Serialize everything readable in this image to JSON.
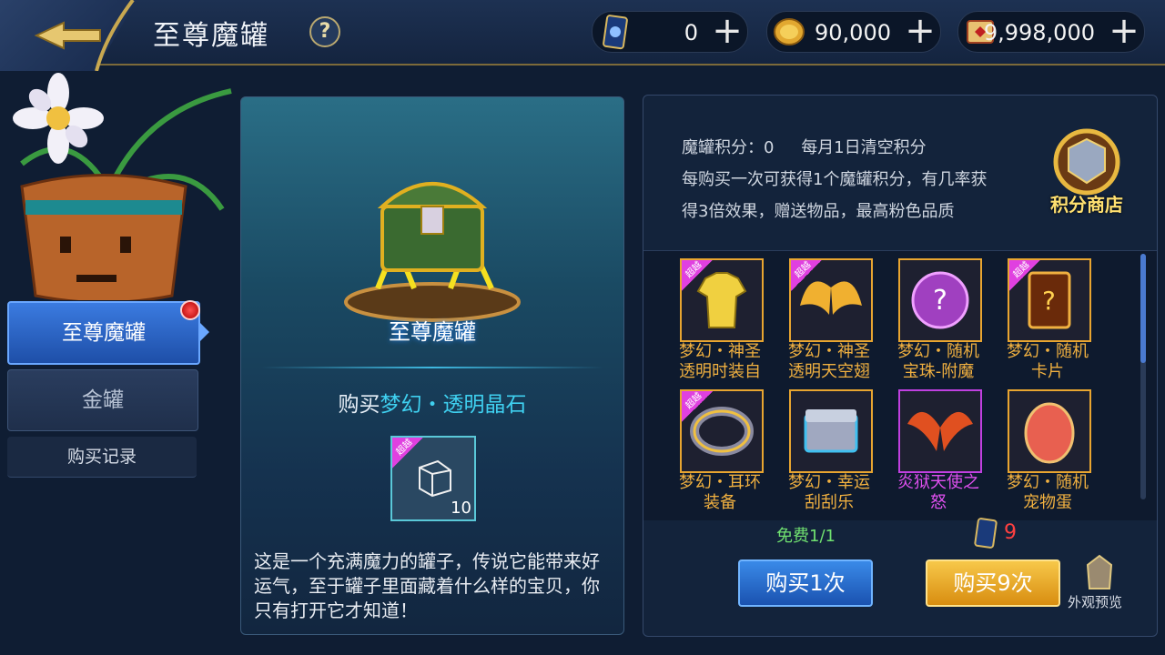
{
  "header": {
    "title": "至尊魔罐",
    "help_icon": "?",
    "currencies": [
      {
        "icon": "card-icon",
        "value": "0"
      },
      {
        "icon": "gold-coin-icon",
        "value": "90,000"
      },
      {
        "icon": "scroll-icon",
        "value": "9,998,000"
      }
    ],
    "plus": "+"
  },
  "sidebar": {
    "tabs": [
      {
        "label": "至尊魔罐",
        "active": true
      },
      {
        "label": "金罐",
        "active": false
      }
    ],
    "history_label": "购买记录"
  },
  "center": {
    "chest_name": "至尊魔罐",
    "buy_prefix": "购买",
    "buy_item": "梦幻・透明晶石",
    "reward_tag": "超越",
    "reward_qty": "10",
    "description": "这是一个充满魔力的罐子，传说它能带来好运气，至于罐子里面藏着什么样的宝贝，你只有打开它才知道！"
  },
  "right": {
    "points_line": "魔罐积分：0",
    "reset_note": "每月1日清空积分",
    "info": "每购买一次可获得1个魔罐积分，有几率获得3倍效果，赠送物品，最高粉色品质",
    "shop_label": "积分商店",
    "items": [
      {
        "line1": "梦幻・神圣",
        "line2": "透明时装自",
        "tag": "超越",
        "color": "#f0b040",
        "icon": "shirt-icon"
      },
      {
        "line1": "梦幻・神圣",
        "line2": "透明天空翅",
        "tag": "超越",
        "color": "#f0b040",
        "icon": "wings-icon"
      },
      {
        "line1": "梦幻・随机",
        "line2": "宝珠-附魔",
        "tag": "",
        "color": "#f0b040",
        "icon": "orb-icon"
      },
      {
        "line1": "梦幻・随机",
        "line2": "卡片",
        "tag": "超越",
        "color": "#f0b040",
        "icon": "card-icon"
      },
      {
        "line1": "梦幻・耳环",
        "line2": "装备",
        "tag": "超越",
        "color": "#f0b040",
        "icon": "ring-icon"
      },
      {
        "line1": "梦幻・幸运",
        "line2": "刮刮乐",
        "tag": "",
        "color": "#f0b040",
        "icon": "box-icon"
      },
      {
        "line1": "炎狱天使之",
        "line2": "怒",
        "tag": "",
        "color": "#e050f0",
        "icon": "fire-wings-icon"
      },
      {
        "line1": "梦幻・随机",
        "line2": "宠物蛋",
        "tag": "",
        "color": "#f0b040",
        "icon": "egg-icon"
      }
    ],
    "free_label": "免费1/1",
    "cost_value": "9",
    "buy1_label": "购买1次",
    "buy9_label": "购买9次",
    "preview_label": "外观预览"
  }
}
